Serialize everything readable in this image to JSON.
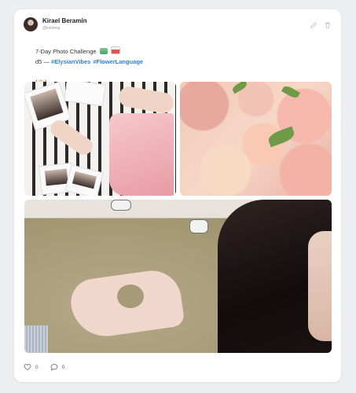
{
  "post": {
    "author_name": "Kirael Beramin",
    "author_handle": "@kirkieraj",
    "line1_text": "7-Day Photo Challenge",
    "line2_prefix": "d5 —",
    "tags": [
      "#ElysianVibes",
      "#FlowerLanguage"
    ],
    "line3": "(🫶🏻)"
  },
  "images": [
    {
      "desc": "Polaroid photos on striped fabric with pink skirt"
    },
    {
      "desc": "Pink and peach hydrangea flowers"
    },
    {
      "desc": "Hand making heart shape over ground"
    }
  ],
  "footer": {
    "like_count": "0",
    "comment_count": "0"
  },
  "icons": {
    "edit": "pencil-icon",
    "delete": "trash-icon",
    "like": "heart-icon",
    "comment": "comment-icon"
  },
  "colors": {
    "tag": "#2f7fd6",
    "background": "#eceef1",
    "card": "#ffffff"
  }
}
